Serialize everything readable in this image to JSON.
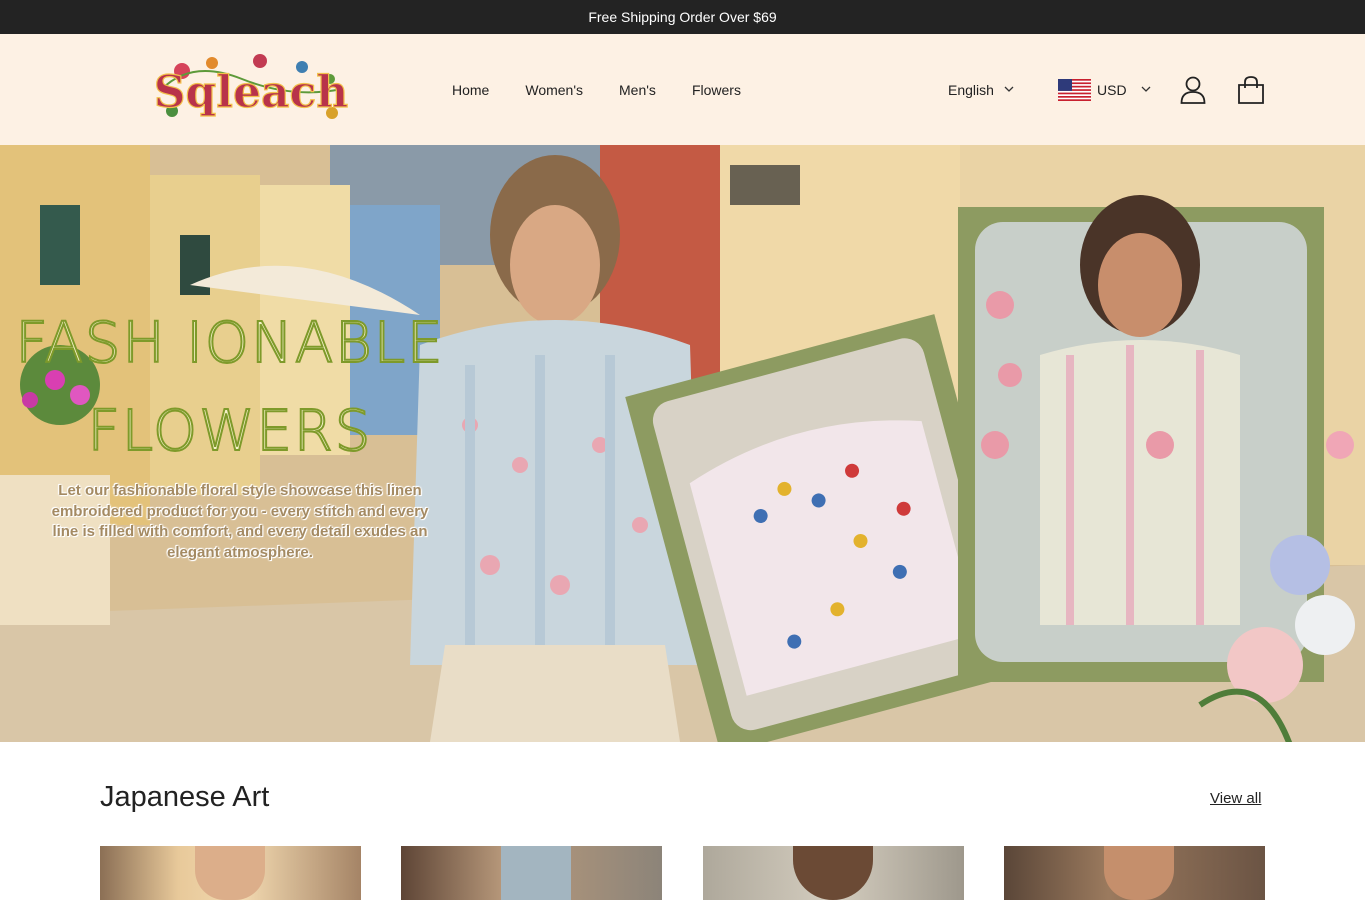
{
  "announcement": "Free Shipping Order Over $69",
  "logo": {
    "text": "Sqleach"
  },
  "nav": [
    {
      "label": "Home"
    },
    {
      "label": "Women's"
    },
    {
      "label": "Men's"
    },
    {
      "label": "Flowers"
    }
  ],
  "language": {
    "selected": "English"
  },
  "currency": {
    "selected": "USD",
    "flag": "us-flag-icon"
  },
  "icons": {
    "account": "account-icon",
    "cart": "cart-icon"
  },
  "hero": {
    "title_line1": "FASH IONABLE",
    "title_line2": "FLOWERS",
    "description": "Let our fashionable floral style showcase this linen embroidered product for you - every stitch and every line is filled with comfort, and every detail exudes an elegant atmosphere."
  },
  "collection": {
    "title": "Japanese Art",
    "view_all": "View all"
  },
  "colors": {
    "announcement_bg": "#232323",
    "header_bg": "#fdf1e4",
    "frame_green": "#8d9b61",
    "title_green": "#7e9a2a"
  }
}
